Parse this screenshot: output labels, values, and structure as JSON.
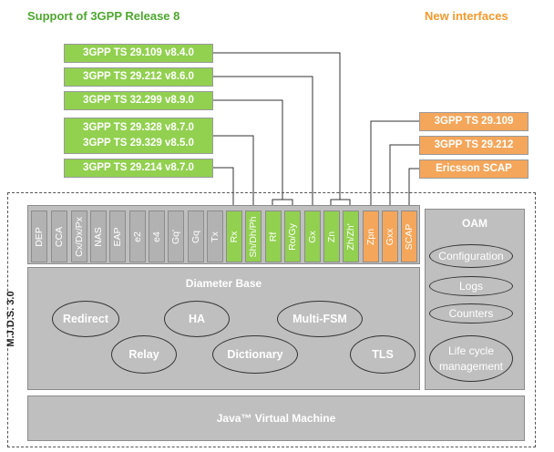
{
  "header": {
    "left_title": "Support of 3GPP Release 8",
    "right_title": "New interfaces"
  },
  "release8_specs": [
    "3GPP TS 29.109 v8.4.0",
    "3GPP TS 29.212 v8.6.0",
    "3GPP TS 32.299 v8.9.0",
    "3GPP TS 29.328 v8.7.0\n3GPP TS 29.329 v8.5.0",
    "3GPP TS 29.214 v8.7.0"
  ],
  "new_interface_specs": [
    "3GPP TS 29.109",
    "3GPP TS 29.212",
    "Ericsson SCAP"
  ],
  "framework_label": "M.J.D.S. 3.0",
  "applications": [
    {
      "label": "DEP",
      "kind": "grey"
    },
    {
      "label": "CCA",
      "kind": "grey"
    },
    {
      "label": "Cx/Dx/Px",
      "kind": "grey"
    },
    {
      "label": "NAS",
      "kind": "grey"
    },
    {
      "label": "EAP",
      "kind": "grey"
    },
    {
      "label": "e2",
      "kind": "grey"
    },
    {
      "label": "e4",
      "kind": "grey"
    },
    {
      "label": "Gq'",
      "kind": "grey"
    },
    {
      "label": "Gq",
      "kind": "grey"
    },
    {
      "label": "Tx",
      "kind": "grey"
    },
    {
      "label": "Rx",
      "kind": "green"
    },
    {
      "label": "Sh/Dh/Ph",
      "kind": "green"
    },
    {
      "label": "Rf",
      "kind": "green"
    },
    {
      "label": "Ro/Gy",
      "kind": "green"
    },
    {
      "label": "Gx",
      "kind": "green"
    },
    {
      "label": "Zn",
      "kind": "green"
    },
    {
      "label": "Zh/Zh'",
      "kind": "green"
    },
    {
      "label": "Zpn",
      "kind": "orange"
    },
    {
      "label": "Gxx",
      "kind": "orange"
    },
    {
      "label": "SCAP",
      "kind": "orange"
    }
  ],
  "diameter_base": {
    "title": "Diameter Base",
    "components": [
      "Redirect",
      "HA",
      "Multi-FSM",
      "Relay",
      "Dictionary",
      "TLS"
    ]
  },
  "oam": {
    "title": "OAM",
    "items": [
      "Configuration",
      "Logs",
      "Counters",
      "Life cycle\nmanagement"
    ]
  },
  "jvm_label": "Java™ Virtual Machine",
  "colors": {
    "release8": "#92d050",
    "new_interface": "#f4a65b",
    "panel": "#bfbfbf",
    "header_green": "#4ea72e",
    "header_orange": "#f39a2d"
  }
}
